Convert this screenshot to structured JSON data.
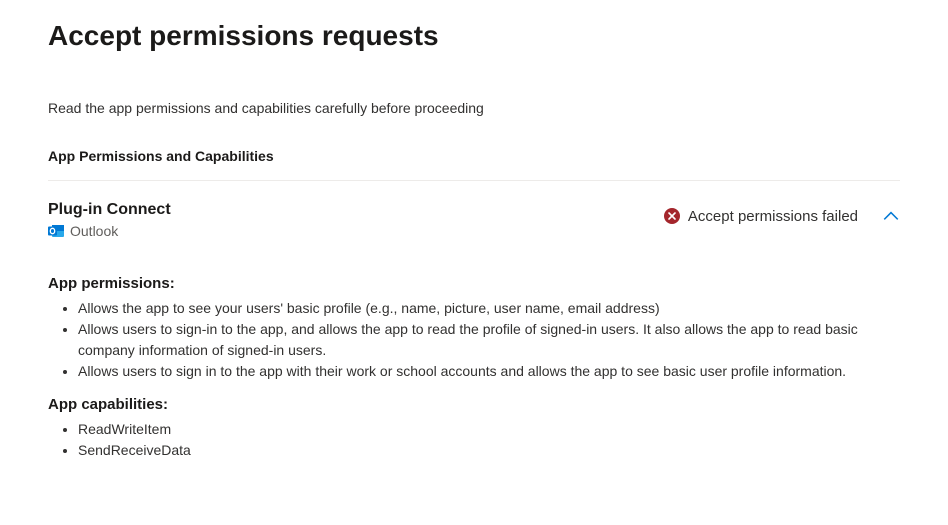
{
  "header": {
    "title": "Accept permissions requests",
    "intro": "Read the app permissions and capabilities carefully before proceeding",
    "section_heading": "App Permissions and Capabilities"
  },
  "plugin": {
    "name": "Plug-in Connect",
    "product": "Outlook",
    "status_text": "Accept permissions failed"
  },
  "details": {
    "permissions_heading": "App permissions:",
    "permissions": [
      "Allows the app to see your users' basic profile (e.g., name, picture, user name, email address)",
      "Allows users to sign-in to the app, and allows the app to read the profile of signed-in users. It also allows the app to read basic company information of signed-in users.",
      "Allows users to sign in to the app with their work or school accounts and allows the app to see basic user profile information."
    ],
    "capabilities_heading": "App capabilities:",
    "capabilities": [
      "ReadWriteItem",
      "SendReceiveData"
    ]
  }
}
